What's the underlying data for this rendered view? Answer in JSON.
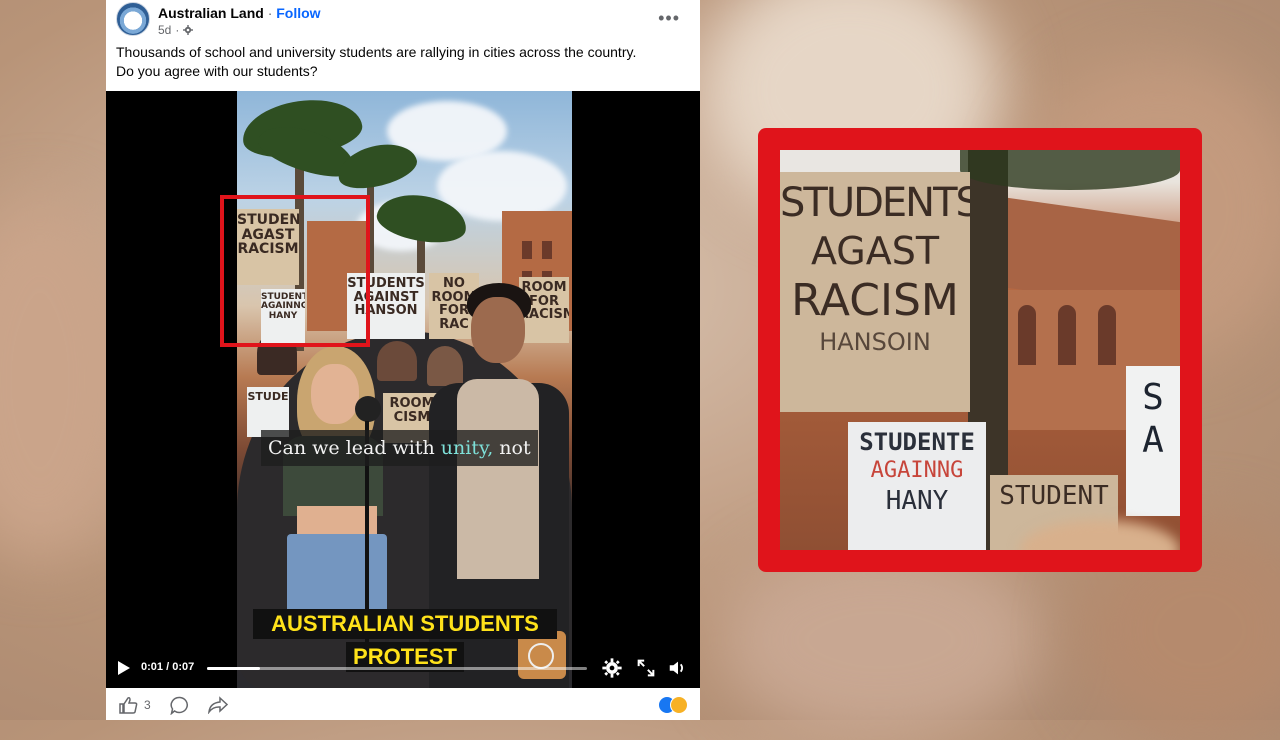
{
  "post": {
    "page_name": "Australian Land",
    "follow_label": "Follow",
    "separator": "·",
    "age": "5d",
    "text_line1": "Thousands of school and university students are rallying in cities across the country.",
    "text_line2": "Do you agree with our students?"
  },
  "video": {
    "signs": {
      "s1": "STUDENTS AGAST RACISM",
      "s1_small": "HANSOIN",
      "s2": "STUDENTS AGAINST HANSON",
      "s3": "NO ROOM FOR RAC",
      "s4": "ROOM FOR RACISM",
      "s5": "STUDENTE AGAINNG HANY",
      "s6": "STUDENT",
      "s7": "STUDE",
      "s8": "ROOM CISM"
    },
    "caption_before": "Can we lead with ",
    "caption_highlight": "unity,",
    "caption_after": " not",
    "title_line1": "AUSTRALIAN STUDENTS",
    "title_line2": "PROTEST",
    "time_current": "0:01",
    "time_separator": "/",
    "time_total": "0:07",
    "progress_fraction": 0.14
  },
  "actions": {
    "like_count": "3"
  },
  "zoom": {
    "sign_main_l1": "STUDENTS",
    "sign_main_l2": "AGAST",
    "sign_main_l3": "RACISM",
    "sign_main_l4": "HANSOIN",
    "sign_lower_l1": "STUDENTE",
    "sign_lower_l2": "AGAINNG",
    "sign_lower_l3": "HANY",
    "sign_mid": "STUDENT",
    "sign_right": "S A"
  },
  "colors": {
    "highlight_red": "#e0141b",
    "follow_blue": "#0866ff",
    "title_yellow": "#ffe21a"
  }
}
